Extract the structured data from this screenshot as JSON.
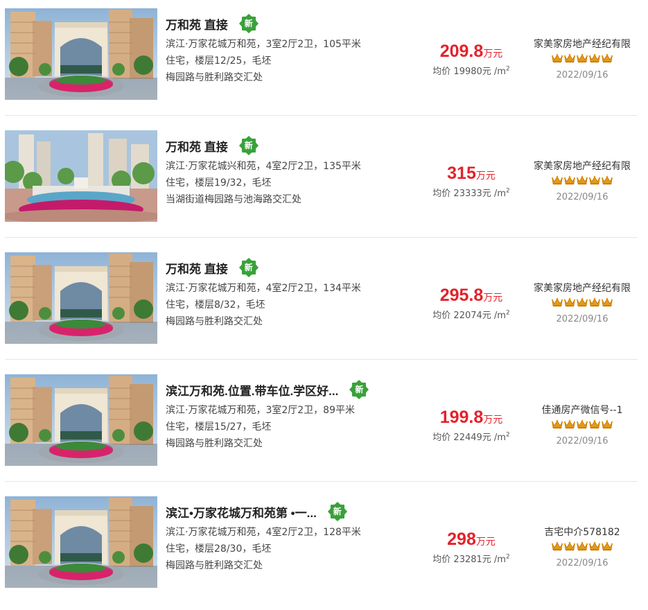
{
  "colors": {
    "price": "#e4222b",
    "badge": "#3aa13a",
    "crown": "#e79a14",
    "divider": "#e6e6e6"
  },
  "listings": [
    {
      "title": "万和苑 直接",
      "badge": "新",
      "line1": "滨江·万家花城万和苑，3室2厅2卫，105平米",
      "line2": "住宅，楼层12/25，毛坯",
      "line3": "梅园路与胜利路交汇处",
      "price": "209.8",
      "price_unit": "万元",
      "unit_price": "均价 19980元 /m",
      "unit_sup": "2",
      "agent": "家美家房地产经纪有限",
      "rating": 5,
      "date": "2022/09/16",
      "photo_icon": "complex-gate-photo"
    },
    {
      "title": "万和苑 直接",
      "badge": "新",
      "line1": "滨江·万家花城兴和苑，4室2厅2卫，135平米",
      "line2": "住宅，楼层19/32，毛坯",
      "line3": "当湖街道梅园路与池海路交汇处",
      "price": "315",
      "price_unit": "万元",
      "unit_price": "均价 23333元 /m",
      "unit_sup": "2",
      "agent": "家美家房地产经纪有限",
      "rating": 5,
      "date": "2022/09/16",
      "photo_icon": "fountain-photo"
    },
    {
      "title": "万和苑 直接",
      "badge": "新",
      "line1": "滨江·万家花城万和苑，4室2厅2卫，134平米",
      "line2": "住宅，楼层8/32，毛坯",
      "line3": "梅园路与胜利路交汇处",
      "price": "295.8",
      "price_unit": "万元",
      "unit_price": "均价 22074元 /m",
      "unit_sup": "2",
      "agent": "家美家房地产经纪有限",
      "rating": 5,
      "date": "2022/09/16",
      "photo_icon": "complex-gate-photo"
    },
    {
      "title": "滨江万和苑.位置.带车位.学区好...",
      "badge": "新",
      "line1": "滨江·万家花城万和苑，3室2厅2卫，89平米",
      "line2": "住宅，楼层15/27，毛坯",
      "line3": "梅园路与胜利路交汇处",
      "price": "199.8",
      "price_unit": "万元",
      "unit_price": "均价 22449元 /m",
      "unit_sup": "2",
      "agent": "佳通房产微信号--1",
      "rating": 5,
      "date": "2022/09/16",
      "photo_icon": "complex-gate-photo"
    },
    {
      "title": "滨江•万家花城万和苑第 •一...",
      "badge": "新",
      "line1": "滨江·万家花城万和苑，4室2厅2卫，128平米",
      "line2": "住宅，楼层28/30，毛坯",
      "line3": "梅园路与胜利路交汇处",
      "price": "298",
      "price_unit": "万元",
      "unit_price": "均价 23281元 /m",
      "unit_sup": "2",
      "agent": "吉宅中介578182",
      "rating": 5,
      "date": "2022/09/16",
      "photo_icon": "complex-gate-photo"
    }
  ]
}
